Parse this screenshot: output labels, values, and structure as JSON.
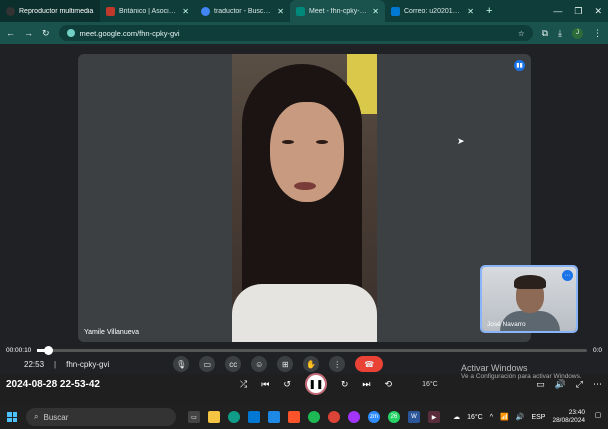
{
  "tabs": [
    {
      "title": "Reproductor multimedia",
      "color": "#222222"
    },
    {
      "title": "Británico | Asociación Cultur",
      "color": "#c0392b"
    },
    {
      "title": "traductor - Buscar con Goo",
      "color": "#4285f4"
    },
    {
      "title": "Meet - fhn-cpky-gvi",
      "color": "#00897b"
    },
    {
      "title": "Correo: u20201016 (Navar",
      "color": "#0078d4"
    }
  ],
  "browser": {
    "url": "meet.google.com/fhn-cpky-gvi",
    "profile_initial": "J"
  },
  "meet": {
    "main_participant": "Yamile Villanueva",
    "self_participant": "José Navarro",
    "time": "22:53",
    "meeting_code": "fhn-cpky-gvi"
  },
  "player": {
    "elapsed": "00:00:10",
    "duration": "0:0",
    "filename": "2024-08-28 22-53-42",
    "progress": 0.02
  },
  "activate": {
    "title": "Activar Windows",
    "subtitle": "Ve a Configuración para activar Windows."
  },
  "taskbar": {
    "search_placeholder": "Buscar",
    "weather": "16°C",
    "weather_mini": "16°C",
    "language": "ESP",
    "time": "23:40",
    "date": "28/08/2024",
    "badge": "26"
  }
}
